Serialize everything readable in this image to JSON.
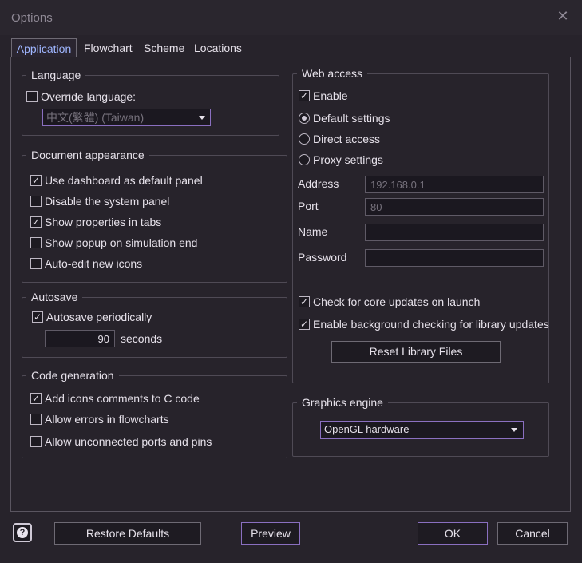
{
  "window": {
    "title": "Options"
  },
  "tabs": [
    "Application",
    "Flowchart",
    "Scheme",
    "Locations"
  ],
  "language": {
    "title": "Language",
    "override_label": "Override language:",
    "override_checked": false,
    "selected": "中文(繁體) (Taiwan)"
  },
  "document": {
    "title": "Document appearance",
    "items": [
      {
        "label": "Use dashboard as default panel",
        "checked": true
      },
      {
        "label": "Disable the system panel",
        "checked": false
      },
      {
        "label": "Show properties in tabs",
        "checked": true
      },
      {
        "label": "Show popup on simulation end",
        "checked": false
      },
      {
        "label": "Auto-edit new icons",
        "checked": false
      }
    ]
  },
  "autosave": {
    "title": "Autosave",
    "periodic_label": "Autosave periodically",
    "periodic_checked": true,
    "value": "90",
    "unit": "seconds"
  },
  "codegen": {
    "title": "Code generation",
    "items": [
      {
        "label": "Add icons comments to C code",
        "checked": true
      },
      {
        "label": "Allow errors in flowcharts",
        "checked": false
      },
      {
        "label": "Allow unconnected ports and pins",
        "checked": false
      }
    ]
  },
  "web": {
    "title": "Web access",
    "enable_label": "Enable",
    "enable_checked": true,
    "radios": [
      {
        "label": "Default settings",
        "selected": true
      },
      {
        "label": "Direct access",
        "selected": false
      },
      {
        "label": "Proxy settings",
        "selected": false
      }
    ],
    "fields": {
      "address_label": "Address",
      "address_value": "192.168.0.1",
      "port_label": "Port",
      "port_value": "80",
      "name_label": "Name",
      "name_value": "",
      "password_label": "Password",
      "password_value": ""
    },
    "check_updates_label": "Check for core updates on launch",
    "check_updates_checked": true,
    "background_check_label": "Enable background checking for library updates",
    "background_check_checked": true,
    "reset_label": "Reset Library Files"
  },
  "graphics": {
    "title": "Graphics engine",
    "selected": "OpenGL hardware"
  },
  "footer": {
    "help_glyph": "?",
    "restore_label": "Restore Defaults",
    "preview_label": "Preview",
    "ok_label": "OK",
    "cancel_label": "Cancel"
  },
  "icons": {
    "close": "close-icon",
    "help": "help-icon",
    "check": "✓",
    "dropdown": "chevron-down-icon"
  }
}
